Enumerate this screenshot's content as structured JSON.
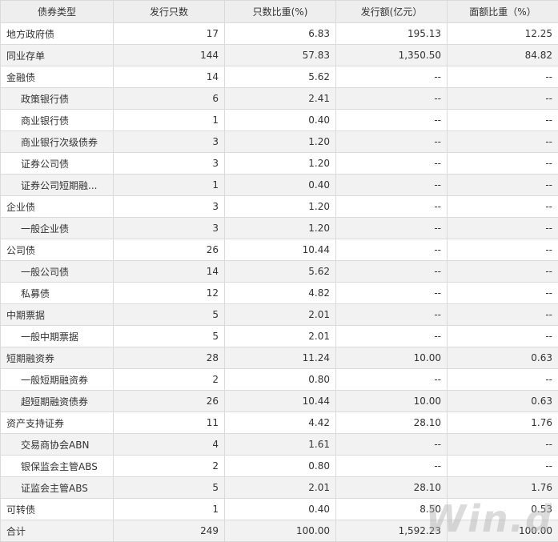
{
  "table": {
    "headers": [
      "债券类型",
      "发行只数",
      "只数比重(%)",
      "发行额(亿元）",
      "面额比重（%）"
    ],
    "rows": [
      {
        "name": "地方政府债",
        "indent": false,
        "count": "17",
        "count_pct": "6.83",
        "amount": "195.13",
        "amount_pct": "12.25"
      },
      {
        "name": "同业存单",
        "indent": false,
        "count": "144",
        "count_pct": "57.83",
        "amount": "1,350.50",
        "amount_pct": "84.82"
      },
      {
        "name": "金融债",
        "indent": false,
        "count": "14",
        "count_pct": "5.62",
        "amount": "--",
        "amount_pct": "--"
      },
      {
        "name": "政策银行债",
        "indent": true,
        "count": "6",
        "count_pct": "2.41",
        "amount": "--",
        "amount_pct": "--"
      },
      {
        "name": "商业银行债",
        "indent": true,
        "count": "1",
        "count_pct": "0.40",
        "amount": "--",
        "amount_pct": "--"
      },
      {
        "name": "商业银行次级债券",
        "indent": true,
        "count": "3",
        "count_pct": "1.20",
        "amount": "--",
        "amount_pct": "--"
      },
      {
        "name": "证券公司债",
        "indent": true,
        "count": "3",
        "count_pct": "1.20",
        "amount": "--",
        "amount_pct": "--"
      },
      {
        "name": "证券公司短期融...",
        "indent": true,
        "count": "1",
        "count_pct": "0.40",
        "amount": "--",
        "amount_pct": "--"
      },
      {
        "name": "企业债",
        "indent": false,
        "count": "3",
        "count_pct": "1.20",
        "amount": "--",
        "amount_pct": "--"
      },
      {
        "name": "一般企业债",
        "indent": true,
        "count": "3",
        "count_pct": "1.20",
        "amount": "--",
        "amount_pct": "--"
      },
      {
        "name": "公司债",
        "indent": false,
        "count": "26",
        "count_pct": "10.44",
        "amount": "--",
        "amount_pct": "--"
      },
      {
        "name": "一般公司债",
        "indent": true,
        "count": "14",
        "count_pct": "5.62",
        "amount": "--",
        "amount_pct": "--"
      },
      {
        "name": "私募债",
        "indent": true,
        "count": "12",
        "count_pct": "4.82",
        "amount": "--",
        "amount_pct": "--"
      },
      {
        "name": "中期票据",
        "indent": false,
        "count": "5",
        "count_pct": "2.01",
        "amount": "--",
        "amount_pct": "--"
      },
      {
        "name": "一般中期票据",
        "indent": true,
        "count": "5",
        "count_pct": "2.01",
        "amount": "--",
        "amount_pct": "--"
      },
      {
        "name": "短期融资券",
        "indent": false,
        "count": "28",
        "count_pct": "11.24",
        "amount": "10.00",
        "amount_pct": "0.63"
      },
      {
        "name": "一般短期融资券",
        "indent": true,
        "count": "2",
        "count_pct": "0.80",
        "amount": "--",
        "amount_pct": "--"
      },
      {
        "name": "超短期融资债券",
        "indent": true,
        "count": "26",
        "count_pct": "10.44",
        "amount": "10.00",
        "amount_pct": "0.63"
      },
      {
        "name": "资产支持证券",
        "indent": false,
        "count": "11",
        "count_pct": "4.42",
        "amount": "28.10",
        "amount_pct": "1.76"
      },
      {
        "name": "交易商协会ABN",
        "indent": true,
        "count": "4",
        "count_pct": "1.61",
        "amount": "--",
        "amount_pct": "--"
      },
      {
        "name": "银保监会主管ABS",
        "indent": true,
        "count": "2",
        "count_pct": "0.80",
        "amount": "--",
        "amount_pct": "--"
      },
      {
        "name": "证监会主管ABS",
        "indent": true,
        "count": "5",
        "count_pct": "2.01",
        "amount": "28.10",
        "amount_pct": "1.76"
      },
      {
        "name": "可转债",
        "indent": false,
        "count": "1",
        "count_pct": "0.40",
        "amount": "8.50",
        "amount_pct": "0.53"
      },
      {
        "name": "合计",
        "indent": false,
        "count": "249",
        "count_pct": "100.00",
        "amount": "1,592.23",
        "amount_pct": "100.00"
      }
    ]
  },
  "watermark": "Win.d",
  "colors": {
    "header_bg": "#eeeeee",
    "alt_row_bg": "#f2f2f2",
    "border": "#dadada",
    "text": "#333333"
  }
}
